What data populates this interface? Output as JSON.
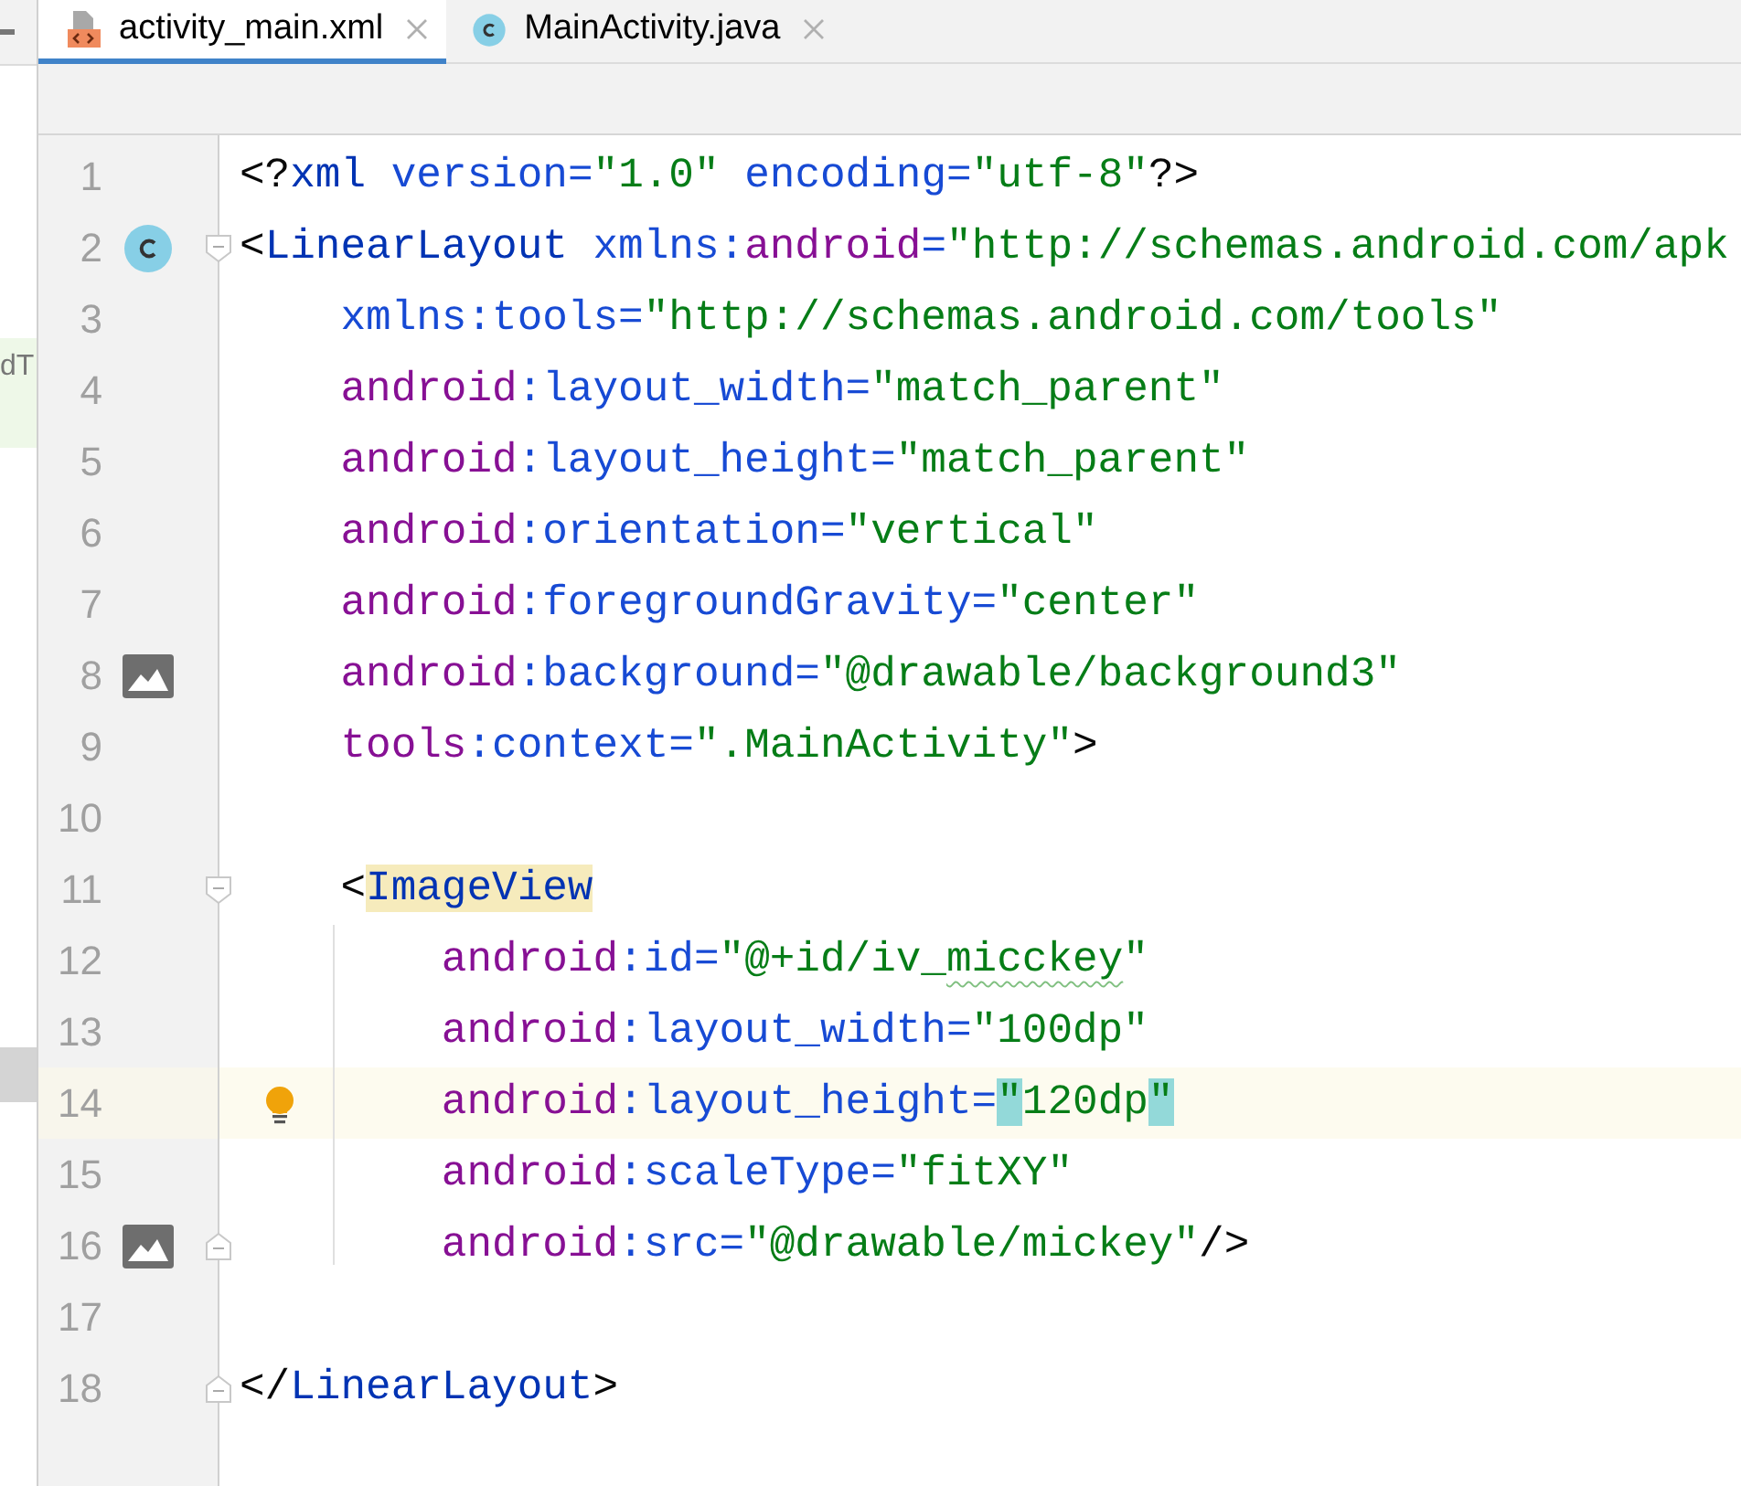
{
  "side_panel": {
    "fragment": "dT"
  },
  "tabs": [
    {
      "label": "activity_main.xml",
      "kind": "xml",
      "selected": true
    },
    {
      "label": "MainActivity.java",
      "kind": "class",
      "selected": false
    }
  ],
  "editor": {
    "lines": [
      {
        "number": "1",
        "current": false,
        "fold_start": false,
        "fold_end": false,
        "tokens": [
          {
            "kind": "punct",
            "text": "<?"
          },
          {
            "kind": "tag",
            "text": "xml"
          },
          {
            "kind": "attr",
            "text": " version="
          },
          {
            "kind": "str",
            "text": "\"1.0\""
          },
          {
            "kind": "attr",
            "text": " encoding="
          },
          {
            "kind": "str",
            "text": "\"utf-8\""
          },
          {
            "kind": "punct",
            "text": "?>"
          }
        ]
      },
      {
        "number": "2",
        "current": false,
        "fold_start": true,
        "fold_end": false,
        "gutter": {
          "kind": "class"
        },
        "tokens": [
          {
            "kind": "punct",
            "text": "<"
          },
          {
            "kind": "tag",
            "text": "LinearLayout"
          },
          {
            "kind": "attr",
            "text": " xmlns:"
          },
          {
            "kind": "ns",
            "text": "android"
          },
          {
            "kind": "attr",
            "text": "="
          },
          {
            "kind": "str",
            "text": "\"http://schemas.android.com/apk"
          }
        ]
      },
      {
        "number": "3",
        "current": false,
        "fold_start": false,
        "fold_end": false,
        "tokens": [
          {
            "kind": "attr",
            "text": "    xmlns:tools="
          },
          {
            "kind": "str",
            "text": "\"http://schemas.android.com/tools\""
          }
        ]
      },
      {
        "number": "4",
        "current": false,
        "fold_start": false,
        "fold_end": false,
        "tokens": [
          {
            "kind": "ns",
            "text": "    android"
          },
          {
            "kind": "attr",
            "text": ":layout_width="
          },
          {
            "kind": "str",
            "text": "\"match_parent\""
          }
        ]
      },
      {
        "number": "5",
        "current": false,
        "fold_start": false,
        "fold_end": false,
        "tokens": [
          {
            "kind": "ns",
            "text": "    android"
          },
          {
            "kind": "attr",
            "text": ":layout_height="
          },
          {
            "kind": "str",
            "text": "\"match_parent\""
          }
        ]
      },
      {
        "number": "6",
        "current": false,
        "fold_start": false,
        "fold_end": false,
        "tokens": [
          {
            "kind": "ns",
            "text": "    android"
          },
          {
            "kind": "attr",
            "text": ":orientation="
          },
          {
            "kind": "str",
            "text": "\"vertical\""
          }
        ]
      },
      {
        "number": "7",
        "current": false,
        "fold_start": false,
        "fold_end": false,
        "tokens": [
          {
            "kind": "ns",
            "text": "    android"
          },
          {
            "kind": "attr",
            "text": ":foregroundGravity="
          },
          {
            "kind": "str",
            "text": "\"center\""
          }
        ]
      },
      {
        "number": "8",
        "current": false,
        "fold_start": false,
        "fold_end": false,
        "gutter": {
          "kind": "image"
        },
        "tokens": [
          {
            "kind": "ns",
            "text": "    android"
          },
          {
            "kind": "attr",
            "text": ":background="
          },
          {
            "kind": "str",
            "text": "\"@drawable/background3\""
          }
        ]
      },
      {
        "number": "9",
        "current": false,
        "fold_start": false,
        "fold_end": false,
        "tokens": [
          {
            "kind": "ns",
            "text": "    tools"
          },
          {
            "kind": "attr",
            "text": ":context="
          },
          {
            "kind": "str",
            "text": "\".MainActivity\""
          },
          {
            "kind": "punct",
            "text": ">"
          }
        ]
      },
      {
        "number": "10",
        "current": false,
        "fold_start": false,
        "fold_end": false
      },
      {
        "number": "11",
        "current": false,
        "fold_start": true,
        "fold_end": false,
        "tokens": [
          {
            "kind": "punct",
            "text": "    <"
          },
          {
            "kind": "tag-match",
            "text": "ImageView"
          }
        ]
      },
      {
        "number": "12",
        "current": false,
        "fold_start": false,
        "fold_end": false,
        "tokens": [
          {
            "kind": "ns",
            "text": "        android"
          },
          {
            "kind": "attr",
            "text": ":id="
          },
          {
            "kind": "str",
            "text": "\"@+id/iv_"
          },
          {
            "kind": "typo",
            "text": "micckey"
          },
          {
            "kind": "str",
            "text": "\""
          }
        ]
      },
      {
        "number": "13",
        "current": false,
        "fold_start": false,
        "fold_end": false,
        "tokens": [
          {
            "kind": "ns",
            "text": "        android"
          },
          {
            "kind": "attr",
            "text": ":layout_width="
          },
          {
            "kind": "str",
            "text": "\"100dp\""
          }
        ]
      },
      {
        "number": "14",
        "current": true,
        "fold_start": false,
        "fold_end": false,
        "gutter": {
          "kind": "bulb"
        },
        "tokens": [
          {
            "kind": "ns",
            "text": "        android"
          },
          {
            "kind": "attr",
            "text": ":layout_height="
          },
          {
            "kind": "quote-match",
            "text": "\""
          },
          {
            "kind": "str",
            "text": "120dp"
          },
          {
            "kind": "quote-match",
            "text": "\""
          }
        ]
      },
      {
        "number": "15",
        "current": false,
        "fold_start": false,
        "fold_end": false,
        "tokens": [
          {
            "kind": "ns",
            "text": "        android"
          },
          {
            "kind": "attr",
            "text": ":scaleType="
          },
          {
            "kind": "str",
            "text": "\"fitXY\""
          }
        ]
      },
      {
        "number": "16",
        "current": false,
        "fold_start": false,
        "fold_end": true,
        "gutter": {
          "kind": "image"
        },
        "tokens": [
          {
            "kind": "ns",
            "text": "        android"
          },
          {
            "kind": "attr",
            "text": ":src="
          },
          {
            "kind": "str",
            "text": "\"@drawable/mickey\""
          },
          {
            "kind": "punct",
            "text": "/>"
          }
        ]
      },
      {
        "number": "17",
        "current": false,
        "fold_start": false,
        "fold_end": false
      },
      {
        "number": "18",
        "current": false,
        "fold_start": false,
        "fold_end": true,
        "tokens": [
          {
            "kind": "punct",
            "text": "</"
          },
          {
            "kind": "tag",
            "text": "LinearLayout"
          },
          {
            "kind": "punct",
            "text": ">"
          }
        ]
      }
    ]
  }
}
